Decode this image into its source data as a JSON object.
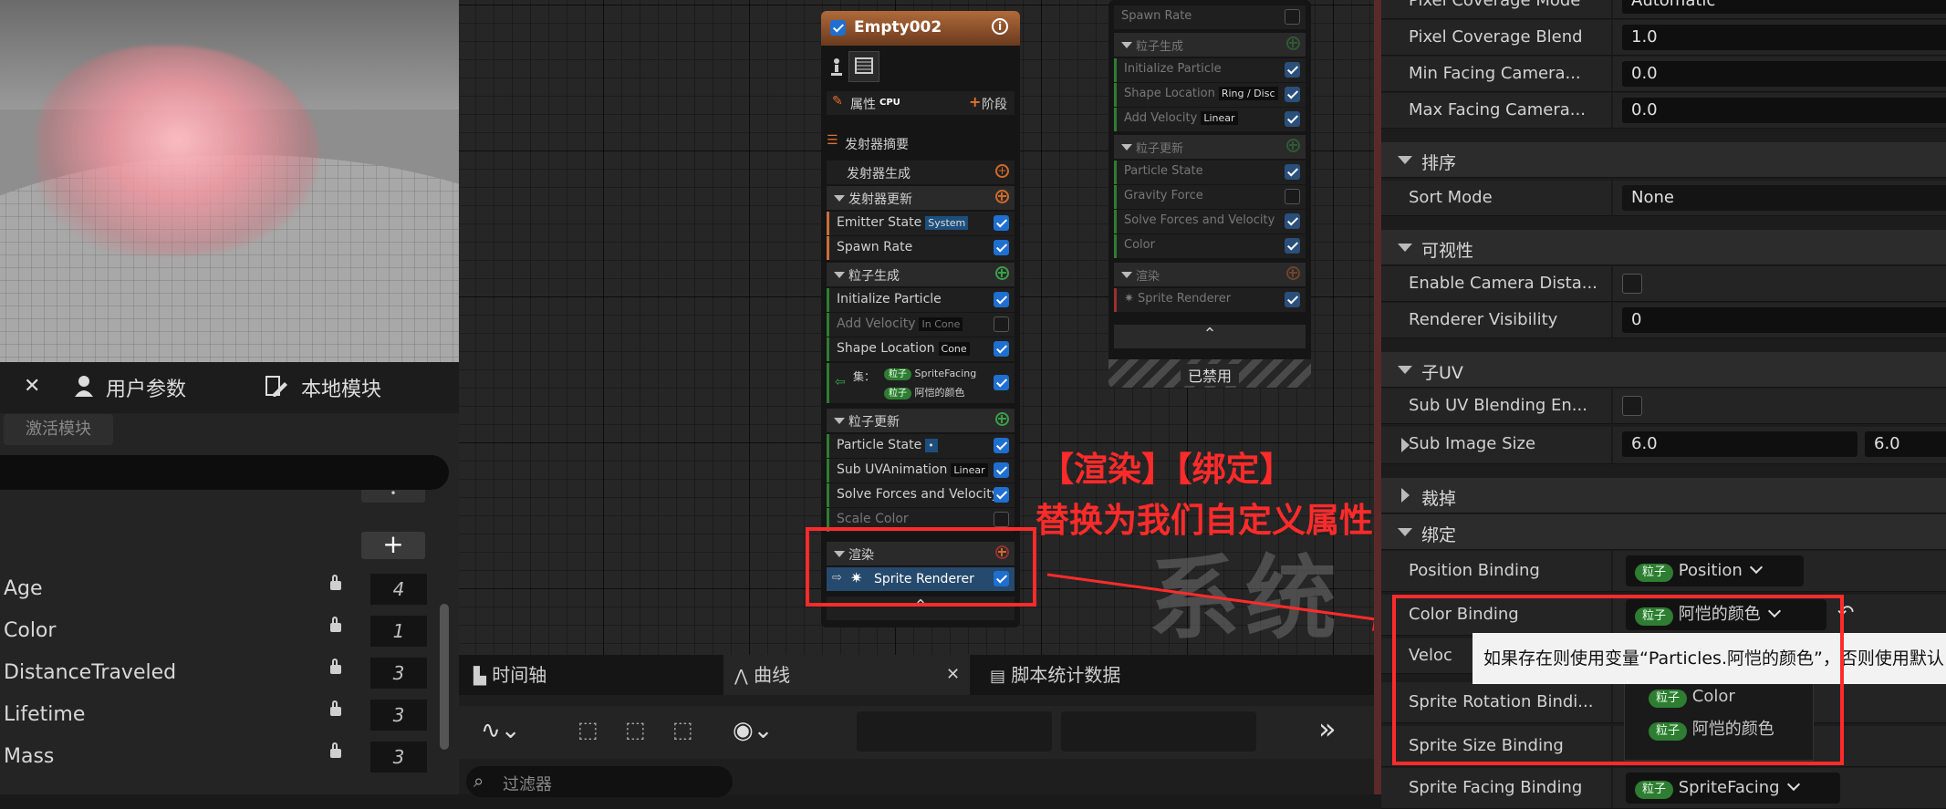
{
  "node": {
    "title": "Empty002",
    "props_label": "属性",
    "cpu_label": "CPU",
    "stage_label": "阶段",
    "summary_label": "发射器摘要",
    "emitter_spawn": "发射器生成",
    "emitter_update": "发射器更新",
    "emitter_state": "Emitter State",
    "emitter_state_tag": "System",
    "spawn_rate": "Spawn Rate",
    "particle_spawn": "粒子生成",
    "init_particle": "Initialize Particle",
    "add_velocity": "Add Velocity",
    "add_velocity_tag": "In Cone",
    "shape_location": "Shape Location",
    "shape_location_tag": "Cone",
    "set_label": "集：",
    "set_pill1": "粒子",
    "set_val1": "SpriteFacing",
    "set_pill2": "粒子",
    "set_val2": "阿恺的颜色",
    "particle_update": "粒子更新",
    "particle_state": "Particle State",
    "sub_uv": "Sub UVAnimation",
    "sub_uv_tag": "Linear",
    "solve_forces": "Solve Forces and Velocity",
    "scale_color": "Scale Color",
    "render": "渲染",
    "sprite_renderer": "Sprite Renderer"
  },
  "node2": {
    "spawn_rate": "Spawn Rate",
    "particle_spawn": "粒子生成",
    "init_particle": "Initialize Particle",
    "shape_location": "Shape Location",
    "shape_location_tag": "Ring / Disc",
    "add_velocity": "Add Velocity",
    "add_velocity_tag": "Linear",
    "particle_update": "粒子更新",
    "particle_state": "Particle State",
    "gravity": "Gravity Force",
    "solve_forces": "Solve Forces and Velocity",
    "color": "Color",
    "render": "渲染",
    "sprite_renderer": "Sprite Renderer",
    "disabled": "已禁用"
  },
  "graph_watermark": "系统",
  "annotation": {
    "line1": "【渲染】【绑定】",
    "line2": "替换为我们自定义属性"
  },
  "left_panel": {
    "tab_user_params": "用户参数",
    "tab_local_modules": "本地模块",
    "active_modules": "激活模块",
    "attributes": [
      {
        "name": "Age",
        "value": "4"
      },
      {
        "name": "Color",
        "value": "1"
      },
      {
        "name": "DistanceTraveled",
        "value": "3"
      },
      {
        "name": "Lifetime",
        "value": "3"
      },
      {
        "name": "Mass",
        "value": "3"
      }
    ]
  },
  "bottom": {
    "tab_timeline": "时间轴",
    "tab_curves": "曲线",
    "tab_script_stats": "脚本统计数据",
    "filter_placeholder": "过滤器"
  },
  "details": {
    "pixel_coverage_mode": {
      "label": "Pixel Coverage Mode",
      "value": "Automatic"
    },
    "pixel_coverage_blend": {
      "label": "Pixel Coverage Blend",
      "value": "1.0"
    },
    "min_facing": {
      "label": "Min Facing Camera...",
      "value": "0.0"
    },
    "max_facing": {
      "label": "Max Facing Camera...",
      "value": "0.0"
    },
    "cat_sort": "排序",
    "sort_mode": {
      "label": "Sort Mode",
      "value": "None"
    },
    "cat_visibility": "可视性",
    "enable_camera_dist": {
      "label": "Enable Camera Dista..."
    },
    "renderer_visibility": {
      "label": "Renderer Visibility",
      "value": "0"
    },
    "cat_subuv": "子UV",
    "subuv_blending": {
      "label": "Sub UV Blending En..."
    },
    "sub_image_size": {
      "label": "Sub Image Size",
      "x": "6.0",
      "y": "6.0"
    },
    "cat_cull": "裁掉",
    "cat_bind": "绑定",
    "position_binding": {
      "label": "Position Binding",
      "pill": "粒子",
      "value": "Position"
    },
    "color_binding": {
      "label": "Color Binding",
      "pill": "粒子",
      "value": "阿恺的颜色"
    },
    "velocity_binding": {
      "label": "Veloc"
    },
    "tooltip": "如果存在则使用变量“Particles.阿恺的颜色”，否则使用默认",
    "sprite_rotation": {
      "label": "Sprite Rotation Bindi..."
    },
    "sprite_size": {
      "label": "Sprite Size Binding"
    },
    "sprite_facing": {
      "label": "Sprite Facing Binding",
      "pill": "粒子",
      "value": "SpriteFacing"
    },
    "dropdown": [
      {
        "pill": "粒子",
        "value": "Color"
      },
      {
        "pill": "粒子",
        "value": "阿恺的颜色"
      }
    ]
  },
  "colors": {
    "accent_red": "#ff2b2b",
    "pill_green": "#2e7d32",
    "check_blue": "#1f6fd1"
  }
}
